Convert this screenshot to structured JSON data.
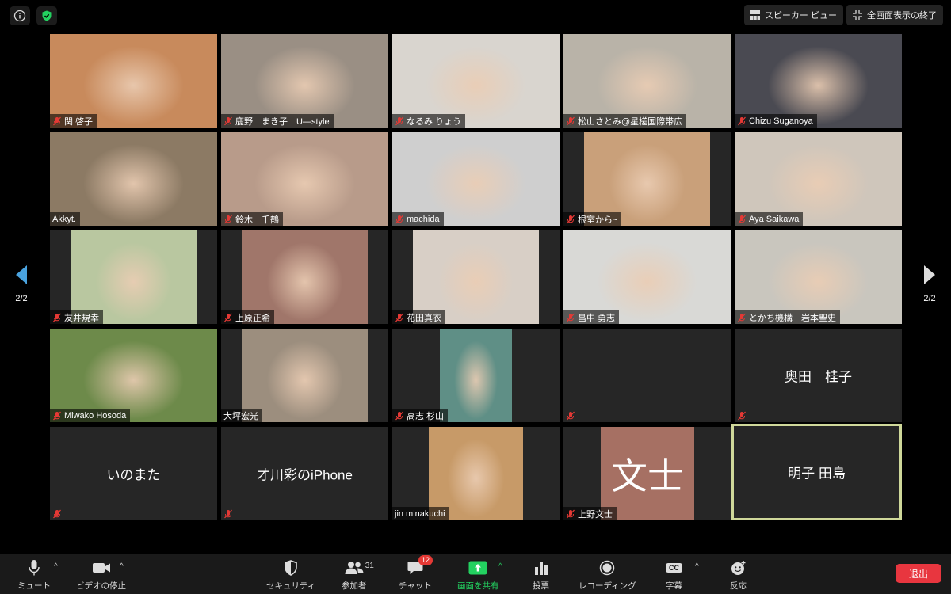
{
  "topbar": {
    "speaker_view_label": "スピーカー ビュー",
    "exit_fullscreen_label": "全画面表示の終了"
  },
  "navigation": {
    "page_left": "2/2",
    "page_right": "2/2"
  },
  "participants": [
    {
      "name": "関 啓子",
      "bg": "#c88a5c"
    },
    {
      "name": "鹿野　まき子　U—style",
      "bg": "#9a8f84"
    },
    {
      "name": "なるみ りょう",
      "bg": "#d9d5cf"
    },
    {
      "name": "松山さとみ@星槎国際帯広",
      "bg": "#b9b3a8"
    },
    {
      "name": "Chizu Suganoya",
      "bg": "#4a4a52"
    },
    {
      "name": "Akkyt.",
      "bg": "#8c7a64"
    },
    {
      "name": "鈴木　千鶴",
      "bg": "#b89b8a"
    },
    {
      "name": "machida",
      "bg": "#cfcfcf"
    },
    {
      "name": "根室から~",
      "bg": "#c9a07a"
    },
    {
      "name": "Aya Saikawa",
      "bg": "#cfc6bb"
    },
    {
      "name": "友井規幸",
      "bg": "#b9c7a0"
    },
    {
      "name": "上原正希",
      "bg": "#a0766a"
    },
    {
      "name": "花田真衣",
      "bg": "#d8cfc6"
    },
    {
      "name": "畠中 勇志",
      "bg": "#d9d9d6"
    },
    {
      "name": "とかち機構　岩本聖史",
      "bg": "#c9c6be"
    },
    {
      "name": "Miwako Hosoda",
      "bg": "#6d8a4a"
    },
    {
      "name": "大坪宏光",
      "bg": "#9c8e7e"
    },
    {
      "name": "高志 杉山",
      "bg": "#5f8f86"
    },
    {
      "name": "",
      "bg": ""
    },
    {
      "name": "奥田　桂子",
      "bg": ""
    },
    {
      "name": "いのまた",
      "bg": ""
    },
    {
      "name": "才川彩のiPhone",
      "bg": ""
    },
    {
      "name": "jin minakuchi",
      "bg": "#c79a68"
    },
    {
      "name": "上野文士",
      "bg": ""
    },
    {
      "name": "明子 田島",
      "bg": ""
    }
  ],
  "avatar_initials": "文士",
  "toolbar": {
    "mute": "ミュート",
    "stop_video": "ビデオの停止",
    "security": "セキュリティ",
    "participants": "参加者",
    "participants_count": "31",
    "chat": "チャット",
    "chat_badge": "12",
    "share_screen": "画面を共有",
    "polls": "投票",
    "recording": "レコーディング",
    "captions": "字幕",
    "cc": "CC",
    "reactions": "反応",
    "end": "退出"
  },
  "colors": {
    "share_green": "#23d160",
    "end_red": "#e8363f",
    "active_speaker_border": "#cfd89a",
    "muted_red": "#e53935"
  }
}
